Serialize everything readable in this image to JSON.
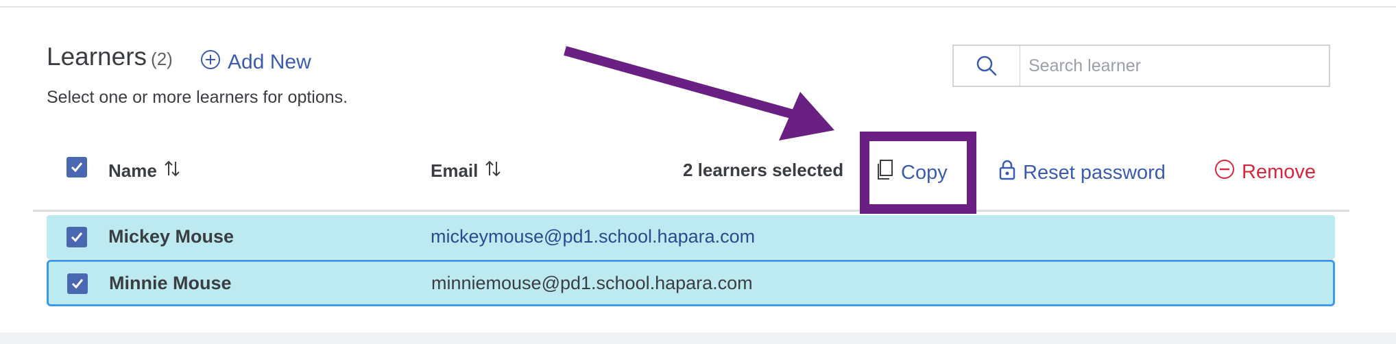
{
  "header": {
    "title": "Learners",
    "count": "(2)",
    "add_new_label": "Add New",
    "subtitle": "Select one or more learners for options."
  },
  "search": {
    "placeholder": "Search learner",
    "icon": "search-icon"
  },
  "table": {
    "columns": {
      "name": "Name",
      "email": "Email"
    },
    "selected_text": "2 learners selected",
    "actions": {
      "copy": "Copy",
      "reset_password": "Reset password",
      "remove": "Remove"
    },
    "rows": [
      {
        "name": "Mickey Mouse",
        "email": "mickeymouse@pd1.school.hapara.com",
        "checked": true
      },
      {
        "name": "Minnie Mouse",
        "email": "minniemouse@pd1.school.hapara.com",
        "checked": true
      }
    ]
  },
  "colors": {
    "accent": "#3a5bb0",
    "danger": "#d7263d",
    "row_selected_bg": "#bdeaf1",
    "row_focus_border": "#3c9be8",
    "annotation": "#6a1f83",
    "checkbox": "#4a68b1"
  }
}
